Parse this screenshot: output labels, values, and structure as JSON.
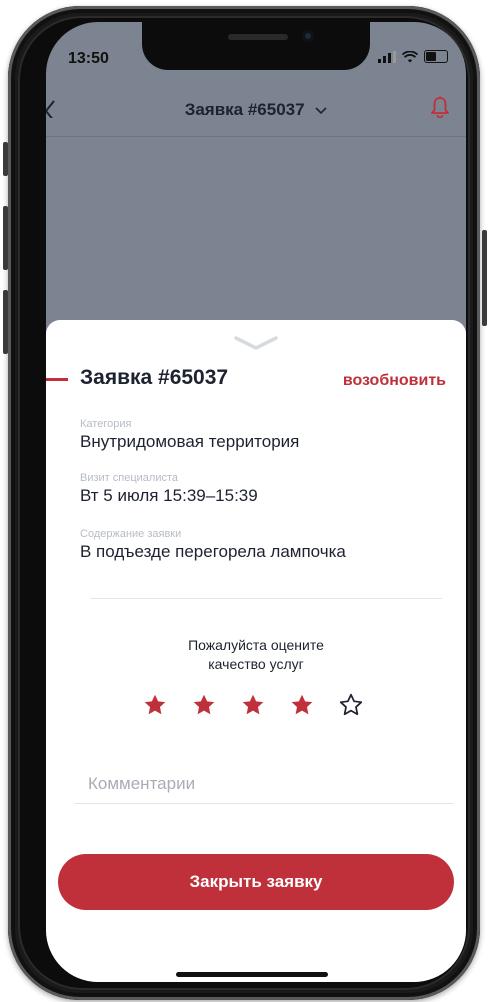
{
  "status_bar": {
    "time": "13:50"
  },
  "header": {
    "title": "Заявка #65037",
    "dropdown_icon": "chevron-down-icon",
    "bell_icon": "bell-icon",
    "back_icon": "chevron-left-icon"
  },
  "request": {
    "title": "Заявка #65037",
    "reopen_label": "возобновить",
    "fields": [
      {
        "label": "Категория",
        "value": "Внутридомовая территория"
      },
      {
        "label": "Визит специалиста",
        "value": "Вт 5 июля 15:39–15:39"
      },
      {
        "label": "Содержание заявки",
        "value": "В подъезде перегорела лампочка"
      }
    ]
  },
  "rating": {
    "prompt_line1": "Пожалуйста оцените",
    "prompt_line2": "качество услуг",
    "value": 4,
    "max": 5
  },
  "comment": {
    "placeholder": "Комментарии",
    "value": ""
  },
  "close_button_label": "Закрыть заявку",
  "colors": {
    "accent": "#c0303a",
    "overlay": "#7c8491",
    "text": "#1d2230"
  }
}
